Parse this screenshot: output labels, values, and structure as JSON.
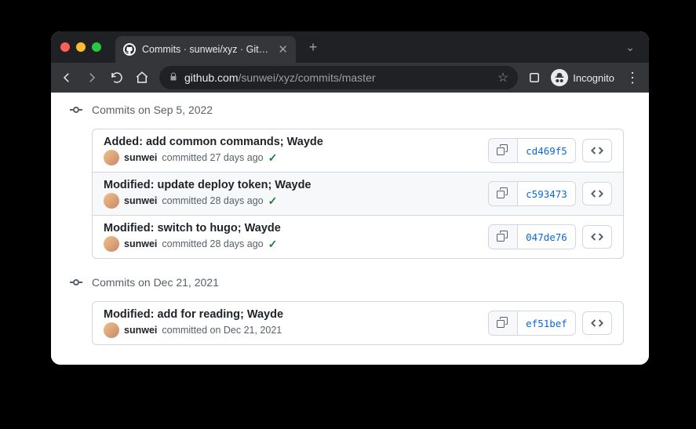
{
  "browser": {
    "tab_title": "Commits · sunwei/xyz · GitHub",
    "url_domain": "github.com",
    "url_path": "/sunwei/xyz/commits/master",
    "incognito_label": "Incognito"
  },
  "commit_groups": [
    {
      "date_label": "Commits on Sep 5, 2022",
      "commits": [
        {
          "title": "Added: add common commands; Wayde",
          "author": "sunwei",
          "meta": "committed 27 days ago",
          "verified": true,
          "sha": "cd469f5",
          "accent": false
        },
        {
          "title": "Modified: update deploy token; Wayde",
          "author": "sunwei",
          "meta": "committed 28 days ago",
          "verified": true,
          "sha": "c593473",
          "accent": true
        },
        {
          "title": "Modified: switch to hugo; Wayde",
          "author": "sunwei",
          "meta": "committed 28 days ago",
          "verified": true,
          "sha": "047de76",
          "accent": false
        }
      ]
    },
    {
      "date_label": "Commits on Dec 21, 2021",
      "commits": [
        {
          "title": "Modified: add for reading; Wayde",
          "author": "sunwei",
          "meta": "committed on Dec 21, 2021",
          "verified": false,
          "sha": "ef51bef",
          "accent": false
        }
      ]
    }
  ]
}
